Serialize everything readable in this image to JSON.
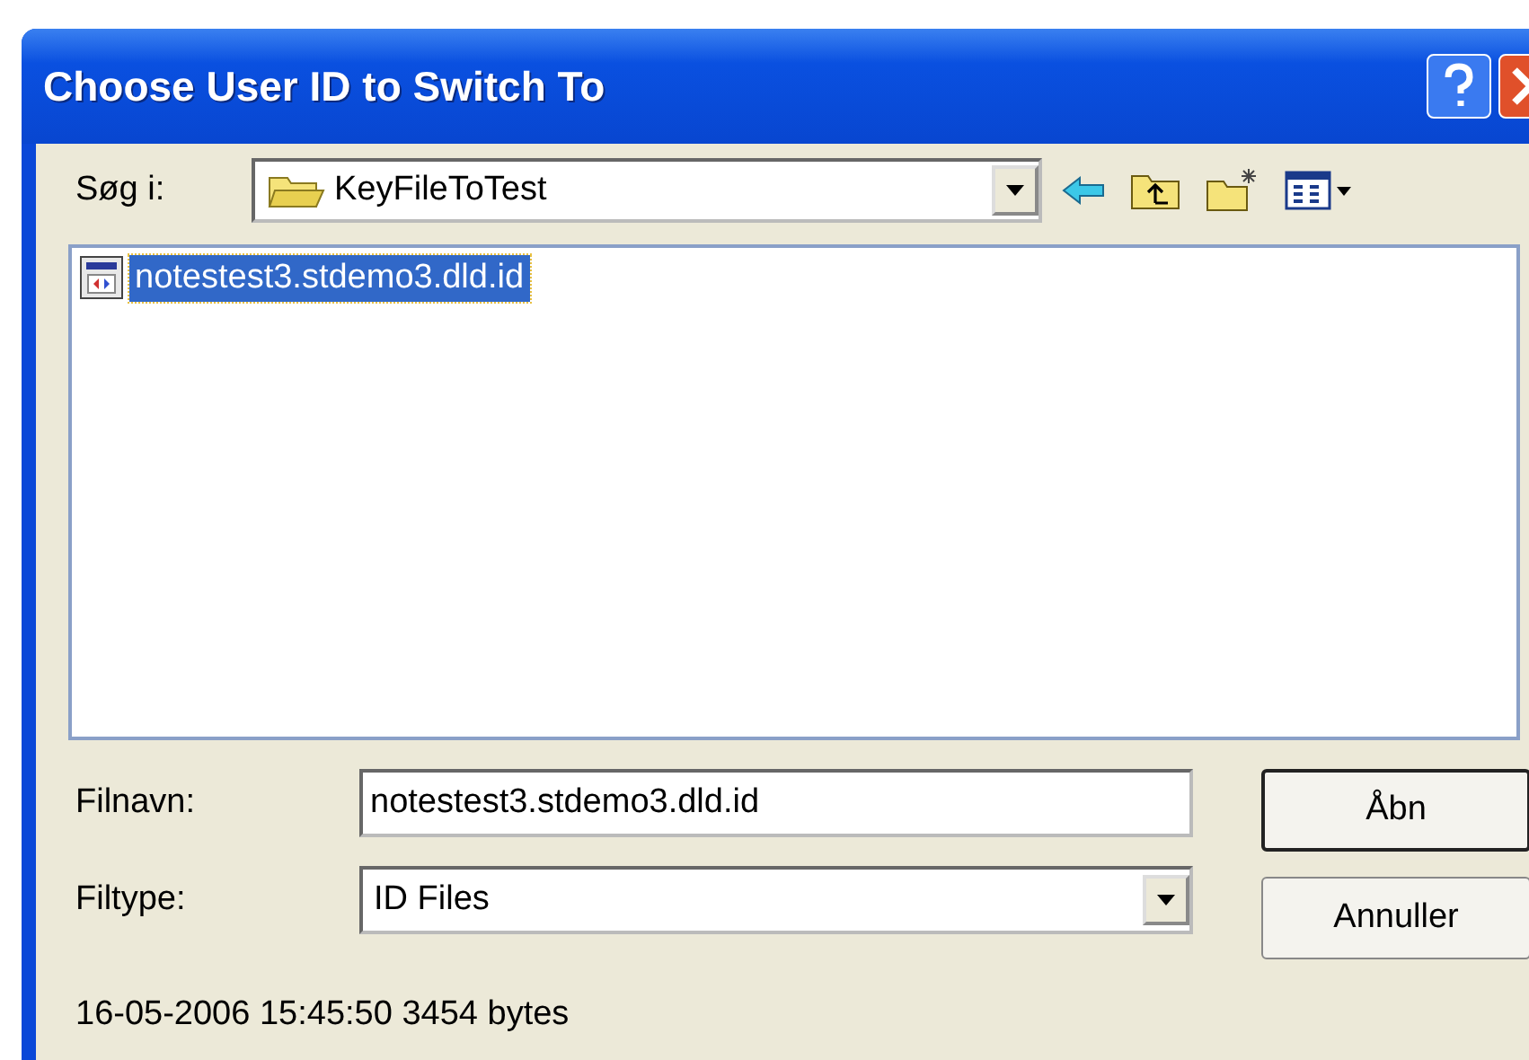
{
  "window": {
    "title": "Choose User ID to Switch To"
  },
  "look_in": {
    "label": "Søg i:",
    "value": "KeyFileToTest"
  },
  "files": [
    {
      "name": "notestest3.stdemo3.dld.id",
      "selected": true
    }
  ],
  "file_name": {
    "label": "Filnavn:",
    "value": "notestest3.stdemo3.dld.id"
  },
  "file_type": {
    "label": "Filtype:",
    "value": "ID Files"
  },
  "buttons": [
    {
      "label": "Åbn",
      "default": true
    },
    {
      "label": "Annuller",
      "default": false
    }
  ],
  "status": "16-05-2006 15:45:50 3454 bytes"
}
